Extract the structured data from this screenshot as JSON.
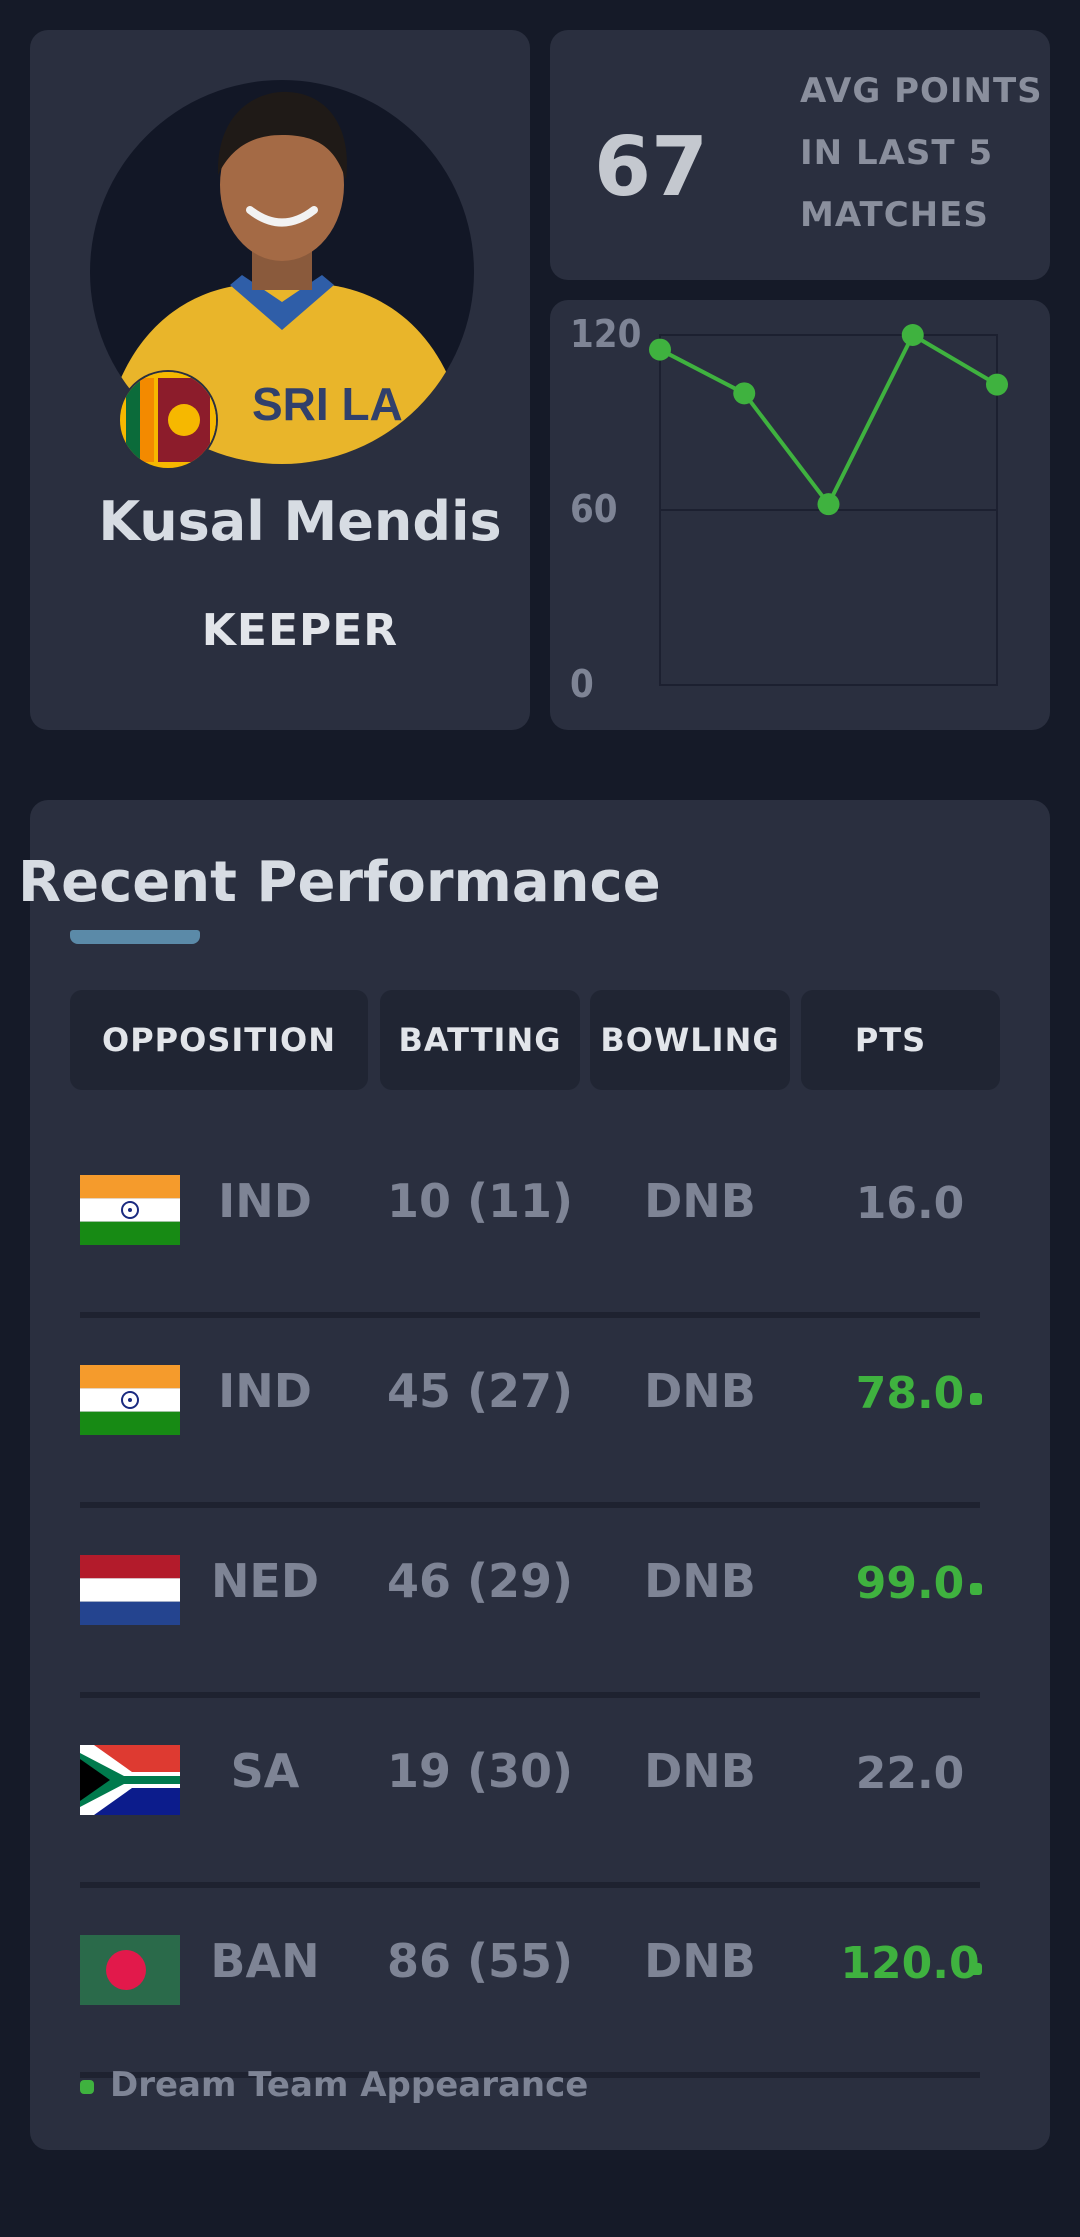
{
  "player": {
    "name": "Kusal Mendis",
    "role": "KEEPER",
    "jersey_text": "SRI LA",
    "country_flag": "sri-lanka-flag"
  },
  "avg": {
    "value": "67",
    "label_lines": [
      "AVG POINTS",
      "IN LAST 5",
      "MATCHES"
    ]
  },
  "chart_data": {
    "type": "line",
    "x": [
      1,
      2,
      3,
      4,
      5
    ],
    "series": [
      {
        "values": [
          115,
          100,
          62,
          120,
          103
        ],
        "color": "#3fb23f"
      }
    ],
    "y_ticks": [
      "120",
      "60",
      "0"
    ],
    "ylim": [
      0,
      120
    ],
    "grid": true
  },
  "performance": {
    "title": "Recent Performance",
    "headers": {
      "opposition": "OPPOSITION",
      "batting": "BATTING",
      "bowling": "BOWLING",
      "pts": "PTS"
    },
    "rows": [
      {
        "team": "IND",
        "flag": "india-flag",
        "batting": "10 (11)",
        "bowling": "DNB",
        "pts": "16.0",
        "dream_team": false
      },
      {
        "team": "IND",
        "flag": "india-flag",
        "batting": "45 (27)",
        "bowling": "DNB",
        "pts": "78.0",
        "dream_team": true
      },
      {
        "team": "NED",
        "flag": "netherlands-flag",
        "batting": "46 (29)",
        "bowling": "DNB",
        "pts": "99.0",
        "dream_team": true
      },
      {
        "team": "SA",
        "flag": "south-africa-flag",
        "batting": "19 (30)",
        "bowling": "DNB",
        "pts": "22.0",
        "dream_team": false
      },
      {
        "team": "BAN",
        "flag": "bangladesh-flag",
        "batting": "86 (55)",
        "bowling": "DNB",
        "pts": "120.0",
        "dream_team": true
      }
    ],
    "legend": "Dream Team Appearance"
  },
  "colors": {
    "background": "#151a28",
    "card": "#2a2f3f",
    "header_cell": "#202533",
    "accent_green": "#3fb23f",
    "muted_text": "#7e8495",
    "underline": "#5b8aa8"
  }
}
